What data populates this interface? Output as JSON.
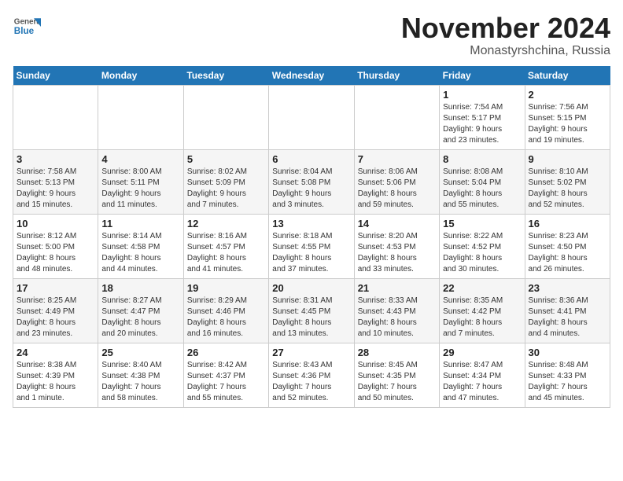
{
  "header": {
    "logo_general": "General",
    "logo_blue": "Blue",
    "title": "November 2024",
    "subtitle": "Monastyrshchina, Russia"
  },
  "weekdays": [
    "Sunday",
    "Monday",
    "Tuesday",
    "Wednesday",
    "Thursday",
    "Friday",
    "Saturday"
  ],
  "weeks": [
    [
      {
        "day": "",
        "info": ""
      },
      {
        "day": "",
        "info": ""
      },
      {
        "day": "",
        "info": ""
      },
      {
        "day": "",
        "info": ""
      },
      {
        "day": "",
        "info": ""
      },
      {
        "day": "1",
        "info": "Sunrise: 7:54 AM\nSunset: 5:17 PM\nDaylight: 9 hours\nand 23 minutes."
      },
      {
        "day": "2",
        "info": "Sunrise: 7:56 AM\nSunset: 5:15 PM\nDaylight: 9 hours\nand 19 minutes."
      }
    ],
    [
      {
        "day": "3",
        "info": "Sunrise: 7:58 AM\nSunset: 5:13 PM\nDaylight: 9 hours\nand 15 minutes."
      },
      {
        "day": "4",
        "info": "Sunrise: 8:00 AM\nSunset: 5:11 PM\nDaylight: 9 hours\nand 11 minutes."
      },
      {
        "day": "5",
        "info": "Sunrise: 8:02 AM\nSunset: 5:09 PM\nDaylight: 9 hours\nand 7 minutes."
      },
      {
        "day": "6",
        "info": "Sunrise: 8:04 AM\nSunset: 5:08 PM\nDaylight: 9 hours\nand 3 minutes."
      },
      {
        "day": "7",
        "info": "Sunrise: 8:06 AM\nSunset: 5:06 PM\nDaylight: 8 hours\nand 59 minutes."
      },
      {
        "day": "8",
        "info": "Sunrise: 8:08 AM\nSunset: 5:04 PM\nDaylight: 8 hours\nand 55 minutes."
      },
      {
        "day": "9",
        "info": "Sunrise: 8:10 AM\nSunset: 5:02 PM\nDaylight: 8 hours\nand 52 minutes."
      }
    ],
    [
      {
        "day": "10",
        "info": "Sunrise: 8:12 AM\nSunset: 5:00 PM\nDaylight: 8 hours\nand 48 minutes."
      },
      {
        "day": "11",
        "info": "Sunrise: 8:14 AM\nSunset: 4:58 PM\nDaylight: 8 hours\nand 44 minutes."
      },
      {
        "day": "12",
        "info": "Sunrise: 8:16 AM\nSunset: 4:57 PM\nDaylight: 8 hours\nand 41 minutes."
      },
      {
        "day": "13",
        "info": "Sunrise: 8:18 AM\nSunset: 4:55 PM\nDaylight: 8 hours\nand 37 minutes."
      },
      {
        "day": "14",
        "info": "Sunrise: 8:20 AM\nSunset: 4:53 PM\nDaylight: 8 hours\nand 33 minutes."
      },
      {
        "day": "15",
        "info": "Sunrise: 8:22 AM\nSunset: 4:52 PM\nDaylight: 8 hours\nand 30 minutes."
      },
      {
        "day": "16",
        "info": "Sunrise: 8:23 AM\nSunset: 4:50 PM\nDaylight: 8 hours\nand 26 minutes."
      }
    ],
    [
      {
        "day": "17",
        "info": "Sunrise: 8:25 AM\nSunset: 4:49 PM\nDaylight: 8 hours\nand 23 minutes."
      },
      {
        "day": "18",
        "info": "Sunrise: 8:27 AM\nSunset: 4:47 PM\nDaylight: 8 hours\nand 20 minutes."
      },
      {
        "day": "19",
        "info": "Sunrise: 8:29 AM\nSunset: 4:46 PM\nDaylight: 8 hours\nand 16 minutes."
      },
      {
        "day": "20",
        "info": "Sunrise: 8:31 AM\nSunset: 4:45 PM\nDaylight: 8 hours\nand 13 minutes."
      },
      {
        "day": "21",
        "info": "Sunrise: 8:33 AM\nSunset: 4:43 PM\nDaylight: 8 hours\nand 10 minutes."
      },
      {
        "day": "22",
        "info": "Sunrise: 8:35 AM\nSunset: 4:42 PM\nDaylight: 8 hours\nand 7 minutes."
      },
      {
        "day": "23",
        "info": "Sunrise: 8:36 AM\nSunset: 4:41 PM\nDaylight: 8 hours\nand 4 minutes."
      }
    ],
    [
      {
        "day": "24",
        "info": "Sunrise: 8:38 AM\nSunset: 4:39 PM\nDaylight: 8 hours\nand 1 minute."
      },
      {
        "day": "25",
        "info": "Sunrise: 8:40 AM\nSunset: 4:38 PM\nDaylight: 7 hours\nand 58 minutes."
      },
      {
        "day": "26",
        "info": "Sunrise: 8:42 AM\nSunset: 4:37 PM\nDaylight: 7 hours\nand 55 minutes."
      },
      {
        "day": "27",
        "info": "Sunrise: 8:43 AM\nSunset: 4:36 PM\nDaylight: 7 hours\nand 52 minutes."
      },
      {
        "day": "28",
        "info": "Sunrise: 8:45 AM\nSunset: 4:35 PM\nDaylight: 7 hours\nand 50 minutes."
      },
      {
        "day": "29",
        "info": "Sunrise: 8:47 AM\nSunset: 4:34 PM\nDaylight: 7 hours\nand 47 minutes."
      },
      {
        "day": "30",
        "info": "Sunrise: 8:48 AM\nSunset: 4:33 PM\nDaylight: 7 hours\nand 45 minutes."
      }
    ]
  ]
}
